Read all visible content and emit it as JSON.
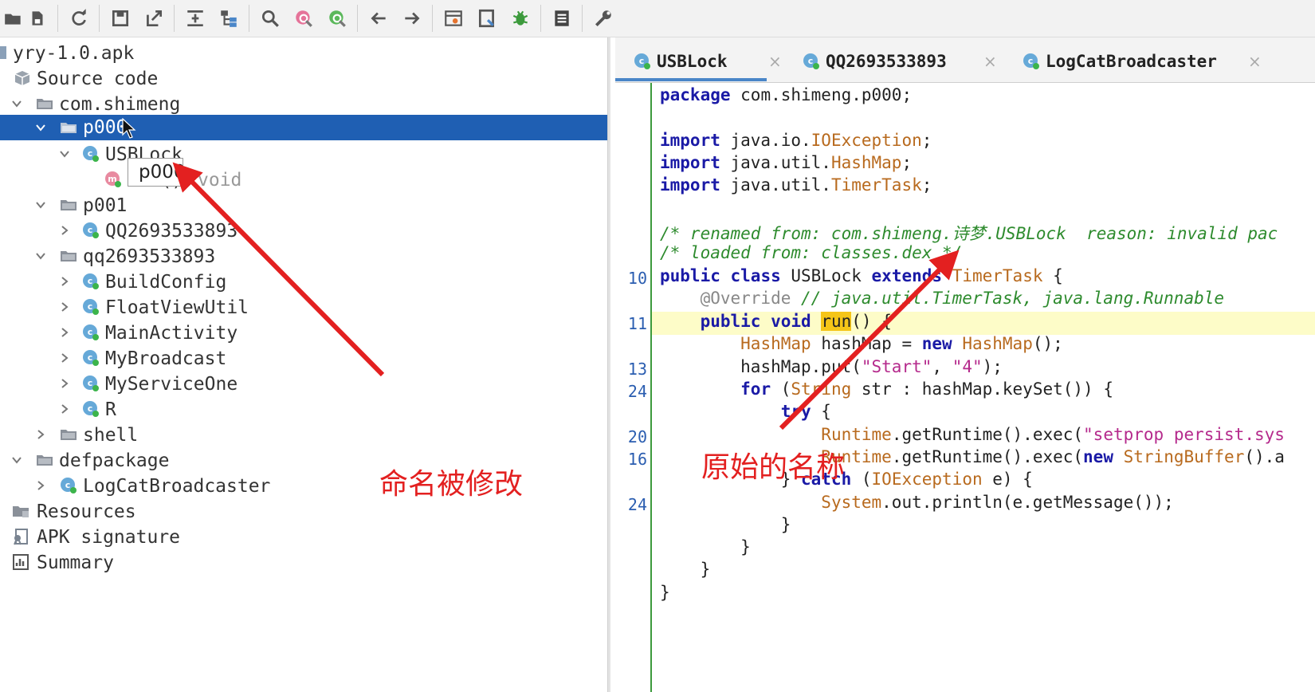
{
  "toolbar": {
    "icons": [
      "open-folder-icon",
      "save-all-icon",
      "sync-icon",
      "save-icon",
      "export-icon",
      "flatten-icon",
      "tree-icon",
      "search-icon",
      "find-class-icon",
      "find-usage-icon",
      "back-icon",
      "forward-icon",
      "decompile-icon",
      "bookmark-icon",
      "debug-icon",
      "log-icon",
      "settings-wrench-icon"
    ]
  },
  "tree": {
    "root": "yry-1.0.apk",
    "source_code": "Source code",
    "pkg_shimeng": "com.shimeng",
    "pkg_p000": "p000",
    "cls_usblock": "USBLock",
    "method_run": "run()",
    "method_run_type": "void",
    "pkg_p001": "p001",
    "cls_qq": "QQ2693533893",
    "pkg_qq": "qq2693533893",
    "cls_buildconfig": "BuildConfig",
    "cls_floatviewutil": "FloatViewUtil",
    "cls_mainactivity": "MainActivity",
    "cls_mybroadcast": "MyBroadcast",
    "cls_myserviceone": "MyServiceOne",
    "cls_r": "R",
    "pkg_shell": "shell",
    "pkg_defpackage": "defpackage",
    "cls_logcat": "LogCatBroadcaster",
    "resources": "Resources",
    "apk_signature": "APK signature",
    "summary": "Summary"
  },
  "tooltip": "p000",
  "tabs": [
    {
      "label": "USBLock",
      "close": "×"
    },
    {
      "label": "QQ2693533893",
      "close": "×"
    },
    {
      "label": "LogCatBroadcaster",
      "close": "×"
    }
  ],
  "code": {
    "line_numbers": [
      "10",
      "11",
      "13",
      "24",
      "20",
      "16",
      "24"
    ],
    "pkg_kw": "package",
    "pkg_name": " com.shimeng.p000;",
    "import_kw": "import",
    "imp1_a": " java.io.",
    "imp1_b": "IOException",
    "imp2_a": " java.util.",
    "imp2_b": "HashMap",
    "imp3_a": " java.util.",
    "imp3_b": "TimerTask",
    "semi": ";",
    "comment1": "/* renamed from: com.shimeng.诗梦.USBLock  reason: invalid pac",
    "comment2": "/* loaded from: classes.dex */",
    "l10_public": "public",
    "l10_class": "class",
    "l10_name": " USBLock ",
    "l10_extends": "extends",
    "l10_type": " TimerTask",
    "l10_brace": " {",
    "override": "@Override",
    "override_comment": " // java.util.TimerTask, java.lang.Runnable",
    "l11_public": "public",
    "l11_void": "void",
    "l11_run": "run",
    "l11_rest": "() {",
    "hm_type": "HashMap",
    "hm_var": " hashMap = ",
    "hm_new": "new",
    "hm_type2": " HashMap",
    "hm_end": "();",
    "put_a": "hashMap.put(",
    "put_s1": "\"Start\"",
    "put_c": ", ",
    "put_s2": "\"4\"",
    "put_end": ");",
    "for_kw": "for",
    "for_a": " (",
    "for_type": "String",
    "for_rest": " str : hashMap.keySet()) {",
    "try_kw": "try",
    "try_rest": " {",
    "rt1_type": "Runtime",
    "rt1_a": ".getRuntime().exec(",
    "rt1_s": "\"setprop persist.sys",
    "rt2_type": "Runtime",
    "rt2_a": ".getRuntime().exec(",
    "rt2_new": "new",
    "rt2_b": " ",
    "rt2_type2": "StringBuffer",
    "rt2_c": "().a",
    "catch_a": "} ",
    "catch_kw": "catch",
    "catch_b": " (",
    "catch_type": "IOException",
    "catch_c": " e) {",
    "sys_type": "System",
    "sys_rest": ".out.println(e.getMessage());",
    "close_brace": "}"
  },
  "annotations": {
    "left": "命名被修改",
    "right": "原始的名称"
  },
  "colors": {
    "selection": "#1f5fb3",
    "annotation": "#e32020",
    "keyword": "#1a1aa6",
    "comment": "#2e8b2e"
  }
}
